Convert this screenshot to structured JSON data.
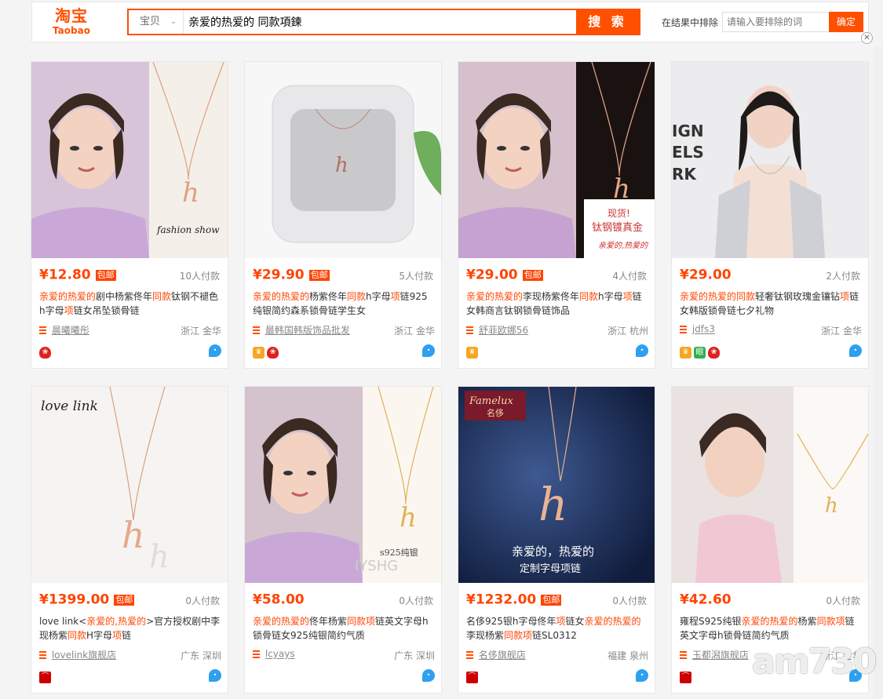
{
  "header": {
    "logo_cn": "淘宝",
    "logo_en": "Taobao",
    "search_category": "宝贝",
    "search_query": "亲爱的热爱的 同款項鍊",
    "search_button": "搜 索",
    "exclude_label": "在结果中排除",
    "exclude_placeholder": "请输入要排除的词",
    "exclude_button": "确定"
  },
  "colors": {
    "accent": "#ff5000",
    "price": "#ff4400"
  },
  "products": [
    {
      "price": "¥12.80",
      "free_shipping": "包邮",
      "sold": "10人付款",
      "title_parts": [
        {
          "t": "亲爱的热爱的",
          "h": true
        },
        {
          "t": "剧中杨紫佟年",
          "h": false
        },
        {
          "t": "同款",
          "h": true
        },
        {
          "t": "钛钢不褪色h字母",
          "h": false
        },
        {
          "t": "项",
          "h": true
        },
        {
          "t": "链女吊坠锁骨链",
          "h": false
        }
      ],
      "shop": "晨曦曦彤",
      "location": "浙江 金华",
      "badges": [
        "flower"
      ],
      "image_text": "fashion show"
    },
    {
      "price": "¥29.90",
      "free_shipping": "包邮",
      "sold": "5人付款",
      "title_parts": [
        {
          "t": "亲爱的热爱的",
          "h": true
        },
        {
          "t": "杨紫佟年",
          "h": false
        },
        {
          "t": "同款",
          "h": true
        },
        {
          "t": "h字母",
          "h": false
        },
        {
          "t": "项",
          "h": true
        },
        {
          "t": "链925纯银简约森系锁骨链学生女",
          "h": false
        }
      ],
      "shop": "最韩国韩版饰品批发",
      "location": "浙江 金华",
      "badges": [
        "crown",
        "flower"
      ],
      "image_text": ""
    },
    {
      "price": "¥29.00",
      "free_shipping": "包邮",
      "sold": "4人付款",
      "title_parts": [
        {
          "t": "亲爱的热爱的",
          "h": true
        },
        {
          "t": "李现杨紫佟年",
          "h": false
        },
        {
          "t": "同款",
          "h": true
        },
        {
          "t": "h字母",
          "h": false
        },
        {
          "t": "项",
          "h": true
        },
        {
          "t": "链女韩商言钛钢锁骨链饰品",
          "h": false
        }
      ],
      "shop": "舒菲欧娜56",
      "location": "浙江 杭州",
      "badges": [
        "crown"
      ],
      "image_text": "现货! 钛钢镀真金"
    },
    {
      "price": "¥29.00",
      "free_shipping": "",
      "sold": "2人付款",
      "title_parts": [
        {
          "t": "亲爱的热爱的",
          "h": true
        },
        {
          "t": "同款",
          "h": true
        },
        {
          "t": "轻奢钛钢玫瑰金镶钻",
          "h": false
        },
        {
          "t": "项",
          "h": true
        },
        {
          "t": "链女韩版锁骨链七夕礼物",
          "h": false
        }
      ],
      "shop": "jdfs3",
      "location": "浙江 金华",
      "badges": [
        "crown",
        "eye",
        "flower"
      ],
      "image_text": "IGN ELS RK"
    },
    {
      "price": "¥1399.00",
      "free_shipping": "包邮",
      "sold": "0人付款",
      "title_parts": [
        {
          "t": "love link<",
          "h": false
        },
        {
          "t": "亲爱的,热爱的",
          "h": true
        },
        {
          "t": ">官方授权剧中李现杨紫",
          "h": false
        },
        {
          "t": "同款",
          "h": true
        },
        {
          "t": "H字母",
          "h": false
        },
        {
          "t": "项",
          "h": true
        },
        {
          "t": "链",
          "h": false
        }
      ],
      "shop": "lovelink旗舰店",
      "location": "广东 深圳",
      "badges": [
        "tmall"
      ],
      "image_text": "love link"
    },
    {
      "price": "¥58.00",
      "free_shipping": "",
      "sold": "0人付款",
      "title_parts": [
        {
          "t": "亲爱的热爱的",
          "h": true
        },
        {
          "t": "佟年杨紫",
          "h": false
        },
        {
          "t": "同款项",
          "h": true
        },
        {
          "t": "链英文字母h锁骨链女925纯银简约气质",
          "h": false
        }
      ],
      "shop": "lcyays",
      "location": "广东 深圳",
      "badges": [],
      "image_text": "s925纯银 IYSHG"
    },
    {
      "price": "¥1232.00",
      "free_shipping": "包邮",
      "sold": "0人付款",
      "title_parts": [
        {
          "t": "名侈925银h字母佟年",
          "h": false
        },
        {
          "t": "项",
          "h": true
        },
        {
          "t": "链女",
          "h": false
        },
        {
          "t": "亲爱的热爱的",
          "h": true
        },
        {
          "t": "李现杨紫",
          "h": false
        },
        {
          "t": "同款项",
          "h": true
        },
        {
          "t": "链SL0312",
          "h": false
        }
      ],
      "shop": "名侈旗舰店",
      "location": "福建 泉州",
      "badges": [
        "tmall"
      ],
      "image_text": "Famelux 名侈 亲爱的，热爱的 定制字母项链"
    },
    {
      "price": "¥42.60",
      "free_shipping": "",
      "sold": "0人付款",
      "title_parts": [
        {
          "t": "雍程S925纯银",
          "h": false
        },
        {
          "t": "亲爱的热爱的",
          "h": true
        },
        {
          "t": "杨紫",
          "h": false
        },
        {
          "t": "同款项",
          "h": true
        },
        {
          "t": "链英文字母h锁骨链简约气质",
          "h": false
        }
      ],
      "shop": "玉都潟旗舰店",
      "location": "浙江 金华",
      "badges": [
        "tmall"
      ],
      "image_text": ""
    }
  ],
  "watermark": "am730"
}
